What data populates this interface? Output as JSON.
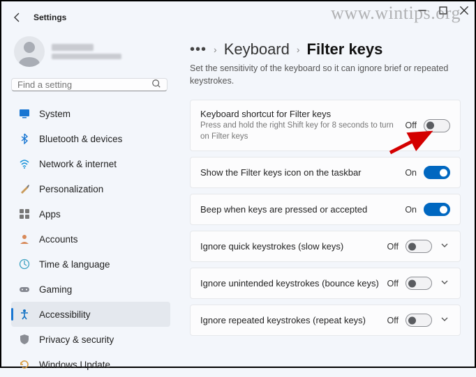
{
  "watermark": "www.wintips.org",
  "window_title": "Settings",
  "search": {
    "placeholder": "Find a setting"
  },
  "nav": {
    "items": [
      {
        "label": "System"
      },
      {
        "label": "Bluetooth & devices"
      },
      {
        "label": "Network & internet"
      },
      {
        "label": "Personalization"
      },
      {
        "label": "Apps"
      },
      {
        "label": "Accounts"
      },
      {
        "label": "Time & language"
      },
      {
        "label": "Gaming"
      },
      {
        "label": "Accessibility"
      },
      {
        "label": "Privacy & security"
      },
      {
        "label": "Windows Update"
      }
    ]
  },
  "breadcrumb": {
    "parent": "Keyboard",
    "current": "Filter keys"
  },
  "subtitle": "Set the sensitivity of the keyboard so it can ignore brief or repeated keystrokes.",
  "settings": [
    {
      "title": "Keyboard shortcut for Filter keys",
      "desc": "Press and hold the right Shift key for 8 seconds to turn on Filter keys",
      "state": "Off",
      "on": false,
      "expandable": false
    },
    {
      "title": "Show the Filter keys icon on the taskbar",
      "desc": "",
      "state": "On",
      "on": true,
      "expandable": false
    },
    {
      "title": "Beep when keys are pressed or accepted",
      "desc": "",
      "state": "On",
      "on": true,
      "expandable": false
    },
    {
      "title": "Ignore quick keystrokes (slow keys)",
      "desc": "",
      "state": "Off",
      "on": false,
      "expandable": true
    },
    {
      "title": "Ignore unintended keystrokes (bounce keys)",
      "desc": "",
      "state": "Off",
      "on": false,
      "expandable": true
    },
    {
      "title": "Ignore repeated keystrokes (repeat keys)",
      "desc": "",
      "state": "Off",
      "on": false,
      "expandable": true
    }
  ]
}
